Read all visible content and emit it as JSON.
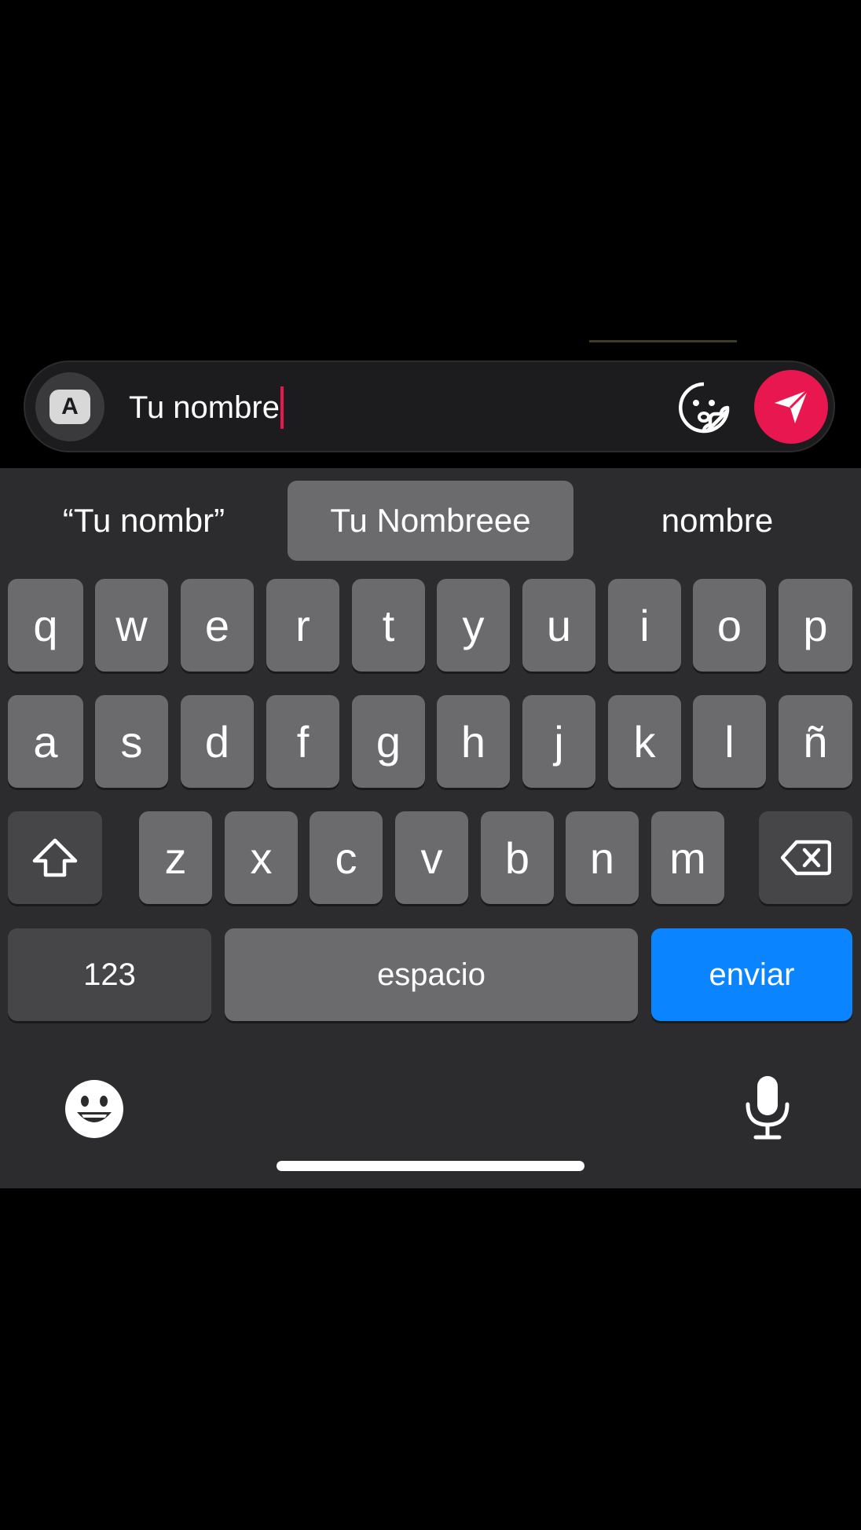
{
  "compose": {
    "text": "Tu nombre",
    "avatar_letter": "A",
    "accent": "#e8174f",
    "icons": {
      "avatar": "text-style-icon",
      "sticker": "sticker-icon",
      "send": "paper-plane-icon"
    }
  },
  "suggestions": [
    "“Tu nombr”",
    "Tu Nombreee",
    "nombre"
  ],
  "keyboard": {
    "row1": [
      "q",
      "w",
      "e",
      "r",
      "t",
      "y",
      "u",
      "i",
      "o",
      "p"
    ],
    "row2": [
      "a",
      "s",
      "d",
      "f",
      "g",
      "h",
      "j",
      "k",
      "l",
      "ñ"
    ],
    "row3": [
      "z",
      "x",
      "c",
      "v",
      "b",
      "n",
      "m"
    ],
    "numbers_label": "123",
    "space_label": "espacio",
    "return_label": "enviar",
    "return_color": "#0a84ff",
    "icons": {
      "shift": "shift-icon",
      "delete": "backspace-icon",
      "emoji": "emoji-icon",
      "dictation": "microphone-icon"
    }
  }
}
